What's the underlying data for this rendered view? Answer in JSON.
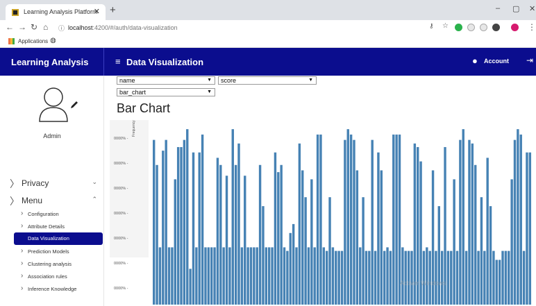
{
  "browser": {
    "tab_title": "Learning Analysis Platform",
    "url_host": "localhost",
    "url_path": ":4200/#/auth/data-visualization",
    "bookmark_apps": "Applications"
  },
  "app": {
    "brand": "Learning Analysis",
    "page_title": "Data Visualization",
    "account_label": "Account"
  },
  "sidebar": {
    "user_name": "Admin",
    "groups": [
      {
        "label": "Privacy",
        "expanded": false
      },
      {
        "label": "Menu",
        "expanded": true
      }
    ],
    "menu_items": [
      {
        "label": "Configuration",
        "active": false
      },
      {
        "label": "Attribute Details",
        "active": false
      },
      {
        "label": "Data Visualization",
        "active": true
      },
      {
        "label": "Prediction Models",
        "active": false
      },
      {
        "label": "Clustering analysis",
        "active": false
      },
      {
        "label": "Association rules",
        "active": false
      },
      {
        "label": "Inference Knowledge",
        "active": false
      }
    ]
  },
  "controls": {
    "attribute_select": "name",
    "value_select": "score",
    "chart_type_select": "bar_chart"
  },
  "chart_title": "Bar Chart",
  "watermark": "Activer Windows",
  "colors": {
    "header": "#0b0d8e",
    "bar": "#4682b4"
  },
  "chart_data": {
    "type": "bar",
    "ylabel": "Frequency",
    "yticks": [
      "0000% -",
      "0000% -",
      "0000% -",
      "0000% -",
      "0000% -",
      "0000% -",
      "0000% -"
    ],
    "values": [
      0.92,
      0.78,
      0.32,
      0.86,
      0.92,
      0.32,
      0.32,
      0.7,
      0.88,
      0.88,
      0.92,
      0.98,
      0.2,
      0.85,
      0.32,
      0.85,
      0.95,
      0.32,
      0.32,
      0.32,
      0.32,
      0.82,
      0.78,
      0.32,
      0.72,
      0.32,
      0.98,
      0.78,
      0.9,
      0.32,
      0.72,
      0.32,
      0.32,
      0.32,
      0.32,
      0.78,
      0.55,
      0.32,
      0.32,
      0.32,
      0.85,
      0.74,
      0.78,
      0.32,
      0.3,
      0.4,
      0.45,
      0.32,
      0.9,
      0.75,
      0.6,
      0.32,
      0.7,
      0.32,
      0.95,
      0.95,
      0.32,
      0.3,
      0.6,
      0.32,
      0.3,
      0.3,
      0.3,
      0.92,
      0.98,
      0.95,
      0.92,
      0.75,
      0.32,
      0.6,
      0.3,
      0.3,
      0.92,
      0.3,
      0.85,
      0.75,
      0.3,
      0.32,
      0.3,
      0.95,
      0.95,
      0.95,
      0.32,
      0.3,
      0.3,
      0.3,
      0.9,
      0.88,
      0.8,
      0.3,
      0.32,
      0.3,
      0.75,
      0.3,
      0.55,
      0.3,
      0.88,
      0.3,
      0.3,
      0.7,
      0.3,
      0.92,
      0.98,
      0.3,
      0.92,
      0.9,
      0.78,
      0.3,
      0.6,
      0.3,
      0.82,
      0.55,
      0.3,
      0.25,
      0.25,
      0.3,
      0.3,
      0.3,
      0.7,
      0.92,
      0.98,
      0.95,
      0.3,
      0.85,
      0.85
    ]
  }
}
